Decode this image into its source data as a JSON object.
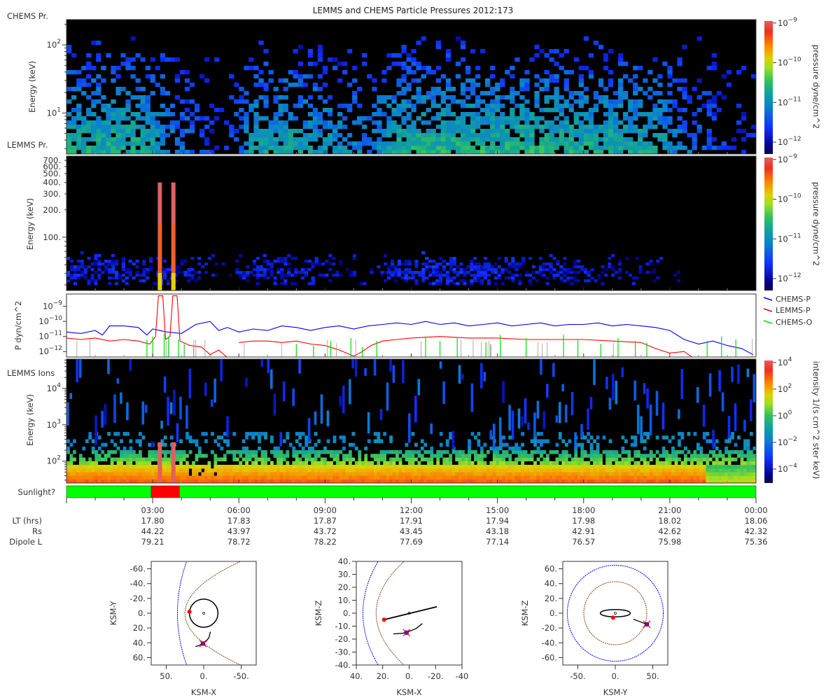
{
  "title": "LEMMS and CHEMS Particle Pressures  2012:173",
  "colors": {
    "chems_p": "#0000ff",
    "lemms_p": "#ff0000",
    "chems_o": "#00e000",
    "sunlit": "#00ff00",
    "eclipse": "#ff0000",
    "bow_shock": "#0000ff",
    "magnetopause": "#8b4513"
  },
  "chart_data": [
    {
      "type": "heatmap",
      "panel_label": "CHEMS Pr.",
      "ylabel": "Energy (keV)",
      "yscale": "log",
      "ylim": [
        2.5,
        235
      ],
      "yticks": [
        {
          "v": 100,
          "label": "10^2"
        },
        {
          "v": 10,
          "label": "10^1"
        }
      ],
      "colorbar": {
        "label": "pressure dyne/cm^2",
        "log_range": [
          -12.3,
          -8.95
        ],
        "ticks": [
          {
            "v": -9,
            "label": "10^-9"
          },
          {
            "v": -10,
            "label": "10^-10"
          },
          {
            "v": -11,
            "label": "10^-11"
          },
          {
            "v": -12,
            "label": "10^-12"
          }
        ]
      },
      "hourly_activity": [
        0.8,
        0.8,
        0.8,
        0.6,
        0.35,
        0.1,
        0.7,
        0.75,
        0.7,
        0.6,
        0.5,
        0.8,
        0.85,
        0.85,
        0.85,
        0.85,
        0.85,
        0.8,
        0.8,
        0.8,
        0.75,
        0.5,
        0.3,
        0.15
      ]
    },
    {
      "type": "heatmap",
      "panel_label": "LEMMS Pr.",
      "ylabel": "Energy (keV)",
      "yscale": "log",
      "ylim": [
        26,
        780
      ],
      "yticks": [
        {
          "v": 100,
          "label": "100."
        },
        {
          "v": 200,
          "label": "200."
        },
        {
          "v": 300,
          "label": "300."
        },
        {
          "v": 400,
          "label": "400."
        },
        {
          "v": 500,
          "label": "500."
        },
        {
          "v": 600,
          "label": "600."
        },
        {
          "v": 700,
          "label": "700."
        }
      ],
      "colorbar": {
        "label": "pressure dyne/cm^2",
        "log_range": [
          -12.3,
          -8.95
        ],
        "ticks": [
          {
            "v": -9,
            "label": "10^-9"
          },
          {
            "v": -10,
            "label": "10^-10"
          },
          {
            "v": -11,
            "label": "10^-11"
          },
          {
            "v": -12,
            "label": "10^-12"
          }
        ]
      },
      "hourly_activity": [
        0.7,
        0.6,
        0.6,
        0.5,
        0.4,
        0.05,
        0.6,
        0.6,
        0.5,
        0.3,
        0.05,
        0.7,
        0.8,
        0.8,
        0.7,
        0.6,
        0.5,
        0.5,
        0.4,
        0.3,
        0.2,
        0.05,
        0,
        0
      ],
      "spikes": [
        {
          "hour": 3.25,
          "top_keV": 400
        },
        {
          "hour": 3.72,
          "top_keV": 400
        }
      ]
    },
    {
      "type": "line",
      "ylabel": "P dyn/cm^2",
      "yscale": "log",
      "log_ylim": [
        -12.36,
        -8.18
      ],
      "yticks": [
        {
          "v": -9,
          "label": "10^-9"
        },
        {
          "v": -10,
          "label": "10^-10"
        },
        {
          "v": -11,
          "label": "10^-11"
        },
        {
          "v": -12,
          "label": "10^-12"
        }
      ],
      "legend": [
        "CHEMS-P",
        "LEMMS-P",
        "CHEMS-O"
      ],
      "series": [
        {
          "name": "CHEMS-P",
          "kind": "line",
          "points": [
            [
              0,
              -10.7
            ],
            [
              0.5,
              -10.8
            ],
            [
              1,
              -10.6
            ],
            [
              1.25,
              -10.9
            ],
            [
              1.5,
              -10.3
            ],
            [
              2,
              -10.3
            ],
            [
              2.5,
              -10.4
            ],
            [
              2.8,
              -10.9
            ],
            [
              3,
              -10.5
            ],
            [
              3.5,
              -10.7
            ],
            [
              4,
              -10.8
            ],
            [
              4.5,
              -10.2
            ],
            [
              5,
              -10.0
            ],
            [
              5.3,
              -10.6
            ],
            [
              5.6,
              -10.4
            ],
            [
              6,
              -10.7
            ],
            [
              6.5,
              -10.5
            ],
            [
              7,
              -10.6
            ],
            [
              7.5,
              -10.3
            ],
            [
              8,
              -10.4
            ],
            [
              8.5,
              -10.6
            ],
            [
              9,
              -10.4
            ],
            [
              9.5,
              -10.3
            ],
            [
              10,
              -10.5
            ],
            [
              10.5,
              -10.3
            ],
            [
              11,
              -10.2
            ],
            [
              11.5,
              -10.1
            ],
            [
              12,
              -10.2
            ],
            [
              12.5,
              -10.0
            ],
            [
              13,
              -10.2
            ],
            [
              13.5,
              -10.1
            ],
            [
              14,
              -10.3
            ],
            [
              14.5,
              -10.2
            ],
            [
              15,
              -10.1
            ],
            [
              15.5,
              -10.3
            ],
            [
              16,
              -10.2
            ],
            [
              16.5,
              -10.1
            ],
            [
              17,
              -10.3
            ],
            [
              17.5,
              -10.2
            ],
            [
              18,
              -10.2
            ],
            [
              18.5,
              -10.1
            ],
            [
              19,
              -10.3
            ],
            [
              19.5,
              -10.2
            ],
            [
              20,
              -10.3
            ],
            [
              20.5,
              -10.4
            ],
            [
              21,
              -10.6
            ],
            [
              21.5,
              -11.2
            ],
            [
              22,
              -11.5
            ],
            [
              22.5,
              -11.3
            ],
            [
              23,
              -11.6
            ],
            [
              23.5,
              -11.8
            ],
            [
              23.9,
              -12.2
            ]
          ]
        },
        {
          "name": "LEMMS-P",
          "kind": "line",
          "points": [
            [
              0,
              -11.1
            ],
            [
              0.5,
              -11.2
            ],
            [
              1,
              -11.1
            ],
            [
              1.5,
              -11.3
            ],
            [
              2,
              -11.2
            ],
            [
              2.5,
              -11.3
            ],
            [
              2.9,
              -11.5
            ],
            [
              3.1,
              -11.0
            ],
            [
              3.2,
              -8.3
            ],
            [
              3.35,
              -8.3
            ],
            [
              3.45,
              -11.2
            ],
            [
              3.6,
              -11.0
            ],
            [
              3.7,
              -8.3
            ],
            [
              3.85,
              -8.3
            ],
            [
              3.95,
              -11.3
            ],
            [
              4.3,
              -11.6
            ],
            [
              4.7,
              -11.7
            ],
            [
              5.0,
              -12.2
            ],
            [
              5.3,
              -11.9
            ],
            [
              5.6,
              -12.4
            ],
            [
              5.8,
              null
            ],
            [
              6.0,
              -11.4
            ],
            [
              6.5,
              -11.3
            ],
            [
              7,
              -11.3
            ],
            [
              7.5,
              -11.4
            ],
            [
              8,
              -11.3
            ],
            [
              8.5,
              -11.5
            ],
            [
              9,
              -11.6
            ],
            [
              9.5,
              -11.9
            ],
            [
              10,
              -12.3
            ],
            [
              10.3,
              -12.0
            ],
            [
              10.6,
              -11.6
            ],
            [
              11,
              -11.3
            ],
            [
              11.5,
              -11.2
            ],
            [
              12,
              -11.1
            ],
            [
              13,
              -11.0
            ],
            [
              14,
              -11.1
            ],
            [
              15,
              -11.1
            ],
            [
              16,
              -11.2
            ],
            [
              17,
              -11.2
            ],
            [
              18,
              -11.2
            ],
            [
              19,
              -11.3
            ],
            [
              20,
              -11.4
            ],
            [
              20.5,
              -11.8
            ],
            [
              21,
              -12.1
            ],
            [
              21.5,
              -12.0
            ],
            [
              21.8,
              -12.4
            ],
            [
              22,
              null
            ],
            [
              22.5,
              -12.4
            ],
            [
              23,
              null
            ]
          ]
        },
        {
          "name": "CHEMS-O",
          "kind": "spikes",
          "points": [
            [
              2.8,
              -11.2
            ],
            [
              3.0,
              -11.0
            ],
            [
              3.4,
              -10.8
            ],
            [
              3.55,
              -11.0
            ],
            [
              3.9,
              -11.2
            ],
            [
              4.1,
              -11.5
            ],
            [
              8.0,
              -11.5
            ],
            [
              8.6,
              -11.6
            ],
            [
              9.2,
              -11.3
            ],
            [
              9.9,
              -11.1
            ],
            [
              10.3,
              -11.7
            ],
            [
              10.8,
              -11.3
            ],
            [
              12.5,
              -11.0
            ],
            [
              13.0,
              -11.3
            ],
            [
              13.6,
              -11.1
            ],
            [
              14.6,
              -11.4
            ],
            [
              15.1,
              -10.9
            ],
            [
              16.0,
              -11.1
            ],
            [
              17.3,
              -10.9
            ],
            [
              17.8,
              -11.2
            ],
            [
              18.6,
              -11.5
            ],
            [
              19.2,
              -11.1
            ],
            [
              19.8,
              -11.3
            ],
            [
              20.2,
              -11.4
            ],
            [
              22.3,
              -11.3
            ],
            [
              22.8,
              -11.0
            ],
            [
              23.3,
              -11.2
            ]
          ]
        }
      ]
    },
    {
      "type": "heatmap",
      "panel_label": "LEMMS Ions",
      "ylabel": "Energy (keV)",
      "yscale": "log",
      "ylim": [
        25,
        64000
      ],
      "yticks": [
        {
          "v": 10000,
          "label": "10^4"
        },
        {
          "v": 1000,
          "label": "10^3"
        },
        {
          "v": 100,
          "label": "10^2"
        }
      ],
      "colorbar": {
        "label": "intensity 1/(s cm^2 ster keV)",
        "log_range": [
          -5.05,
          4.15
        ],
        "ticks": [
          {
            "v": 4,
            "label": "10^4"
          },
          {
            "v": 2,
            "label": "10^2"
          },
          {
            "v": 0,
            "label": "10^0"
          },
          {
            "v": -2,
            "label": "10^-2"
          },
          {
            "v": -4,
            "label": "10^-4"
          }
        ]
      },
      "spikes": [
        {
          "hour": 3.25,
          "top_keV": 330
        },
        {
          "hour": 3.72,
          "top_keV": 330
        }
      ]
    }
  ],
  "sunlight": {
    "label": "Sunlight?",
    "segments": [
      {
        "start_h": 0,
        "end_h": 2.95,
        "state": "sunlit"
      },
      {
        "start_h": 2.95,
        "end_h": 3.93,
        "state": "eclipse"
      },
      {
        "start_h": 3.93,
        "end_h": 24,
        "state": "sunlit"
      }
    ]
  },
  "time_axis": {
    "labels": [
      "03:00",
      "06:00",
      "09:00",
      "12:00",
      "15:00",
      "18:00",
      "21:00",
      "00:00"
    ],
    "rows": [
      {
        "label": "LT (hrs)",
        "values": [
          "17.80",
          "17.83",
          "17.87",
          "17.91",
          "17.94",
          "17.98",
          "18.02",
          "18.06"
        ]
      },
      {
        "label": "Rs",
        "values": [
          "44.22",
          "43.97",
          "43.72",
          "43.45",
          "43.18",
          "42.91",
          "42.62",
          "42.32"
        ]
      },
      {
        "label": "Dipole L",
        "values": [
          "79.21",
          "78.72",
          "78.22",
          "77.69",
          "77.14",
          "76.57",
          "75.98",
          "75.36"
        ]
      }
    ]
  },
  "orbits": [
    {
      "xlabel": "KSM-X",
      "ylabel": "KSM-Y",
      "xrange": [
        70,
        -70
      ],
      "yrange": [
        -70,
        70
      ],
      "xticks": [
        [
          50,
          "50."
        ],
        [
          0,
          "0."
        ],
        [
          -50,
          "-50."
        ]
      ],
      "yticks": [
        [
          -60,
          "-60."
        ],
        [
          -40,
          "-40."
        ],
        [
          -20,
          "-20."
        ],
        [
          0,
          "0."
        ],
        [
          20,
          "20."
        ],
        [
          40,
          "40."
        ],
        [
          60,
          "60."
        ]
      ],
      "bow_shock": {
        "standoff": 35,
        "k": 400
      },
      "magnetopause": {
        "standoff": 25,
        "k": 66
      },
      "orbit_circle": {
        "rx": 19,
        "ry": 19
      },
      "line": [],
      "trajectory": [
        [
          -9,
          25
        ],
        [
          -7,
          33
        ],
        [
          -3,
          38
        ],
        [
          2,
          41
        ],
        [
          7,
          44
        ],
        [
          11,
          45
        ]
      ],
      "start": [
        19,
        -2
      ],
      "end": [
        1,
        41
      ]
    },
    {
      "xlabel": "KSM-X",
      "ylabel": "KSM-Z",
      "xrange": [
        40,
        -40
      ],
      "yrange": [
        40,
        -40
      ],
      "xticks": [
        [
          40,
          "40."
        ],
        [
          20,
          "20."
        ],
        [
          0,
          "0."
        ],
        [
          -20,
          "-20."
        ],
        [
          -40,
          "-40"
        ]
      ],
      "yticks": [
        [
          40,
          "40."
        ],
        [
          30,
          "30."
        ],
        [
          20,
          "20."
        ],
        [
          10,
          "10."
        ],
        [
          0,
          "0."
        ],
        [
          -10,
          "-10."
        ],
        [
          -20,
          "-20."
        ],
        [
          -30,
          "-30."
        ],
        [
          -40,
          "-40."
        ]
      ],
      "bow_shock": {
        "standoff": 35,
        "k": 139
      },
      "magnetopause": {
        "standoff": 25,
        "k": 76
      },
      "orbit_circle": null,
      "line": [
        [
          19,
          -5
        ],
        [
          -21,
          5
        ]
      ],
      "trajectory": [
        [
          12,
          -16
        ],
        [
          5,
          -15.5
        ],
        [
          0,
          -14
        ],
        [
          -5,
          -12
        ],
        [
          -10,
          -8
        ]
      ],
      "start": [
        19,
        -5
      ],
      "end": [
        2,
        -15
      ]
    },
    {
      "xlabel": "KSM-Y",
      "ylabel": "KSM-Z",
      "xrange": [
        -70,
        70
      ],
      "yrange": [
        70,
        -70
      ],
      "xticks": [
        [
          -50,
          "-50."
        ],
        [
          0,
          "0."
        ],
        [
          50,
          "50."
        ]
      ],
      "yticks": [
        [
          60,
          "60."
        ],
        [
          40,
          "40."
        ],
        [
          20,
          "20."
        ],
        [
          0,
          "0."
        ],
        [
          -20,
          "-20."
        ],
        [
          -40,
          "-40."
        ],
        [
          -60,
          "-60."
        ]
      ],
      "bow_shock": {
        "radius": 64
      },
      "magnetopause": {
        "radius": 42
      },
      "orbit_circle": {
        "rx": 20,
        "ry": 5
      },
      "line": [],
      "trajectory": [
        [
          24,
          -8
        ],
        [
          33,
          -11.5
        ],
        [
          42,
          -15
        ]
      ],
      "start": [
        -3,
        -6
      ],
      "end": [
        42,
        -15
      ]
    }
  ]
}
